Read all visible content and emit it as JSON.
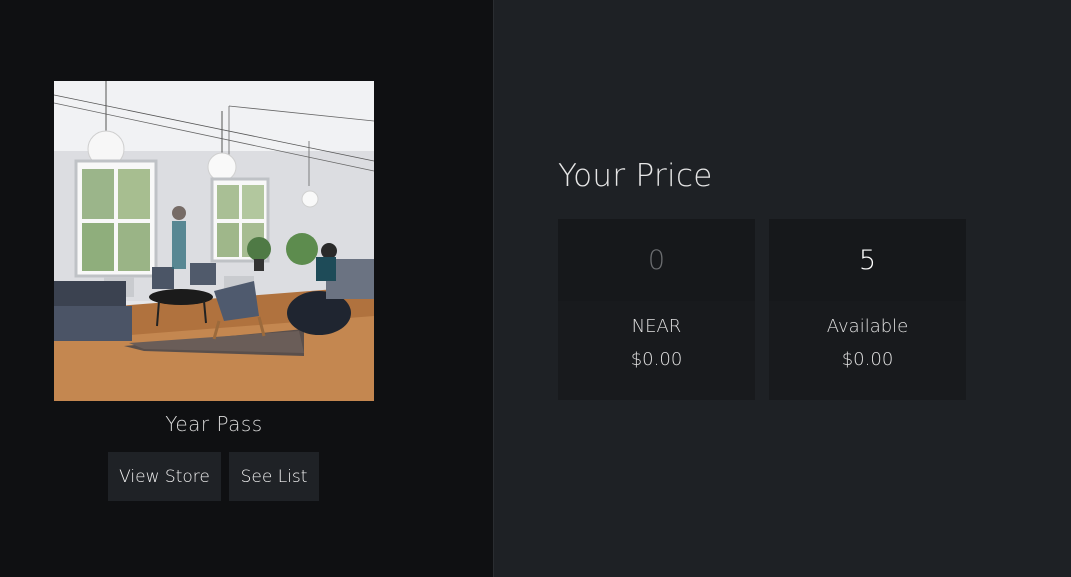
{
  "product": {
    "title": "Year Pass",
    "image_alt": "Bright office lounge with pendant lamps, armchairs and a person walking",
    "buttons": {
      "view_store": "View Store",
      "see_list": "See List"
    }
  },
  "price": {
    "heading": "Your Price",
    "cards": [
      {
        "value": "0",
        "label": "NEAR",
        "amount": "$0.00"
      },
      {
        "value": "5",
        "label": "Available",
        "amount": "$0.00"
      }
    ]
  },
  "colors": {
    "left_bg": "#0f1012",
    "right_bg": "#1e2125",
    "card_bg": "#181a1d",
    "button_bg": "#1f2226"
  }
}
